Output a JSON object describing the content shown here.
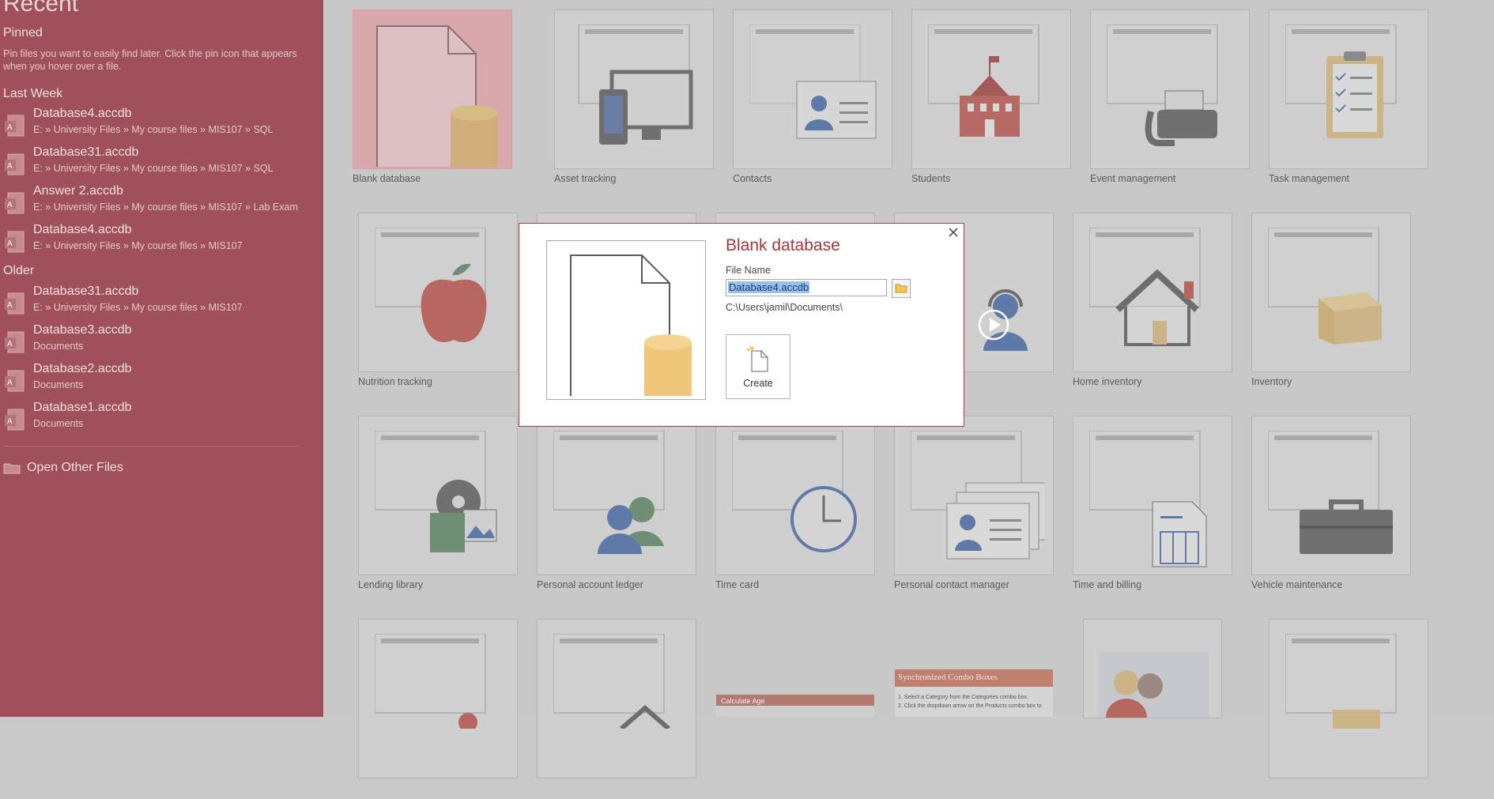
{
  "left": {
    "heading": "Recent",
    "pinned_label": "Pinned",
    "pinned_hint": "Pin files you want to easily find later. Click the pin icon that appears when you hover over a file.",
    "last_week_label": "Last Week",
    "older_label": "Older",
    "last_week_items": [
      {
        "name": "Database4.accdb",
        "path": "E: » University Files » My course files » MIS107 » SQL"
      },
      {
        "name": "Database31.accdb",
        "path": "E: » University Files » My course files » MIS107 » SQL"
      },
      {
        "name": "Answer 2.accdb",
        "path": "E: » University Files » My course files » MIS107 » Lab Exam"
      },
      {
        "name": "Database4.accdb",
        "path": "E: » University Files » My course files » MIS107"
      }
    ],
    "older_items": [
      {
        "name": "Database31.accdb",
        "path": "E: » University Files » My course files » MIS107"
      },
      {
        "name": "Database3.accdb",
        "path": "Documents"
      },
      {
        "name": "Database2.accdb",
        "path": "Documents"
      },
      {
        "name": "Database1.accdb",
        "path": "Documents"
      }
    ],
    "open_other": "Open Other Files"
  },
  "templates": {
    "row1": [
      "Blank database",
      "Asset tracking",
      "Contacts",
      "Students",
      "Event management",
      "Task management"
    ],
    "row2": [
      "Nutrition tracking",
      "",
      "",
      "",
      "Home inventory",
      "Inventory"
    ],
    "row3": [
      "Lending library",
      "Personal account ledger",
      "Time card",
      "Personal contact manager",
      "Time and billing",
      "Vehicle maintenance"
    ],
    "row4_texts": {
      "calc_age": "Calculate Age",
      "sync_combo": "Synchronized Combo Boxes",
      "sync_step1": "1. Select a Category from the Categories combo box.",
      "sync_step2": "2. Click the dropdown arrow on the Products combo box to"
    }
  },
  "dialog": {
    "title": "Blank database",
    "file_name_label": "File Name",
    "file_name_value": "Database4.accdb",
    "path": "C:\\Users\\jamil\\Documents\\",
    "create_label": "Create"
  },
  "colors": {
    "left_bg": "#a0505a",
    "accent": "#a4373a",
    "selection": "#99c0ee"
  }
}
